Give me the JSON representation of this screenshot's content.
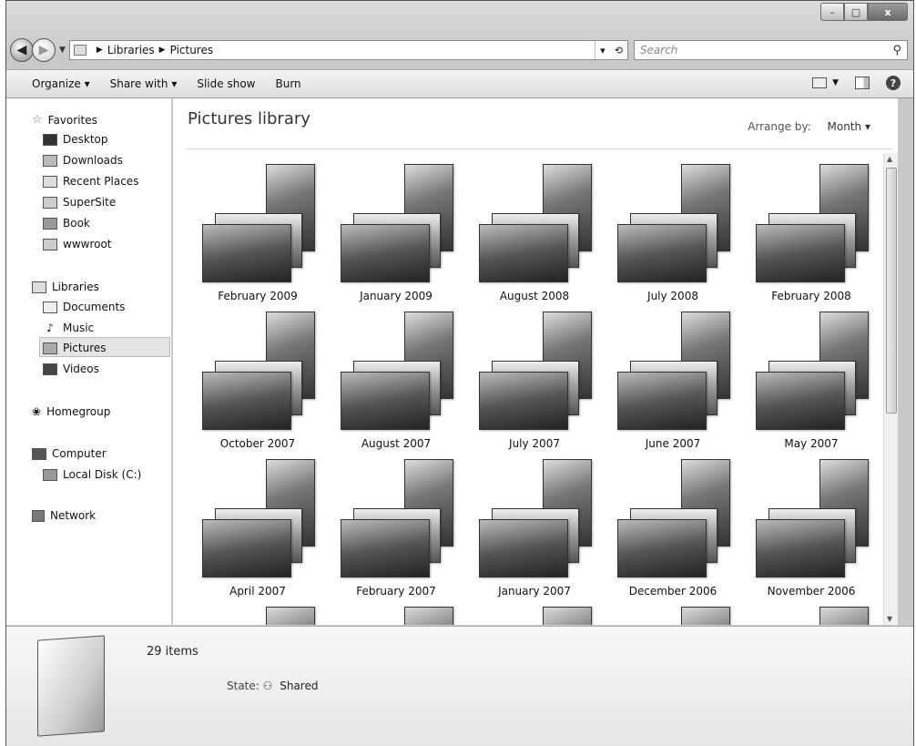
{
  "window": {
    "min_symbol": "–",
    "max_symbol": "▢",
    "close_symbol": "x"
  },
  "address": {
    "path": [
      "Libraries",
      "Pictures"
    ],
    "search_placeholder": "Search"
  },
  "toolbar": {
    "organize": "Organize ▾",
    "share_with": "Share with ▾",
    "slide_show": "Slide show",
    "burn": "Burn"
  },
  "nav": {
    "favorites": "Favorites",
    "favorites_items": [
      "Desktop",
      "Downloads",
      "Recent Places",
      "SuperSite",
      "Book",
      "wwwroot"
    ],
    "libraries": "Libraries",
    "libraries_items": [
      "Documents",
      "Music",
      "Pictures",
      "Videos"
    ],
    "homegroup": "Homegroup",
    "computer": "Computer",
    "computer_items": [
      "Local Disk (C:)"
    ],
    "network": "Network",
    "selected": "Pictures"
  },
  "main": {
    "title": "Pictures library",
    "arrange_label": "Arrange by:",
    "arrange_value": "Month ▾",
    "groups": [
      "February 2009",
      "January 2009",
      "August 2008",
      "July 2008",
      "February 2008",
      "October 2007",
      "August 2007",
      "July 2007",
      "June 2007",
      "May 2007",
      "April 2007",
      "February 2007",
      "January 2007",
      "December 2006",
      "November 2006"
    ]
  },
  "details": {
    "count": "29 items",
    "state_label": "State:",
    "state_value": "Shared"
  }
}
